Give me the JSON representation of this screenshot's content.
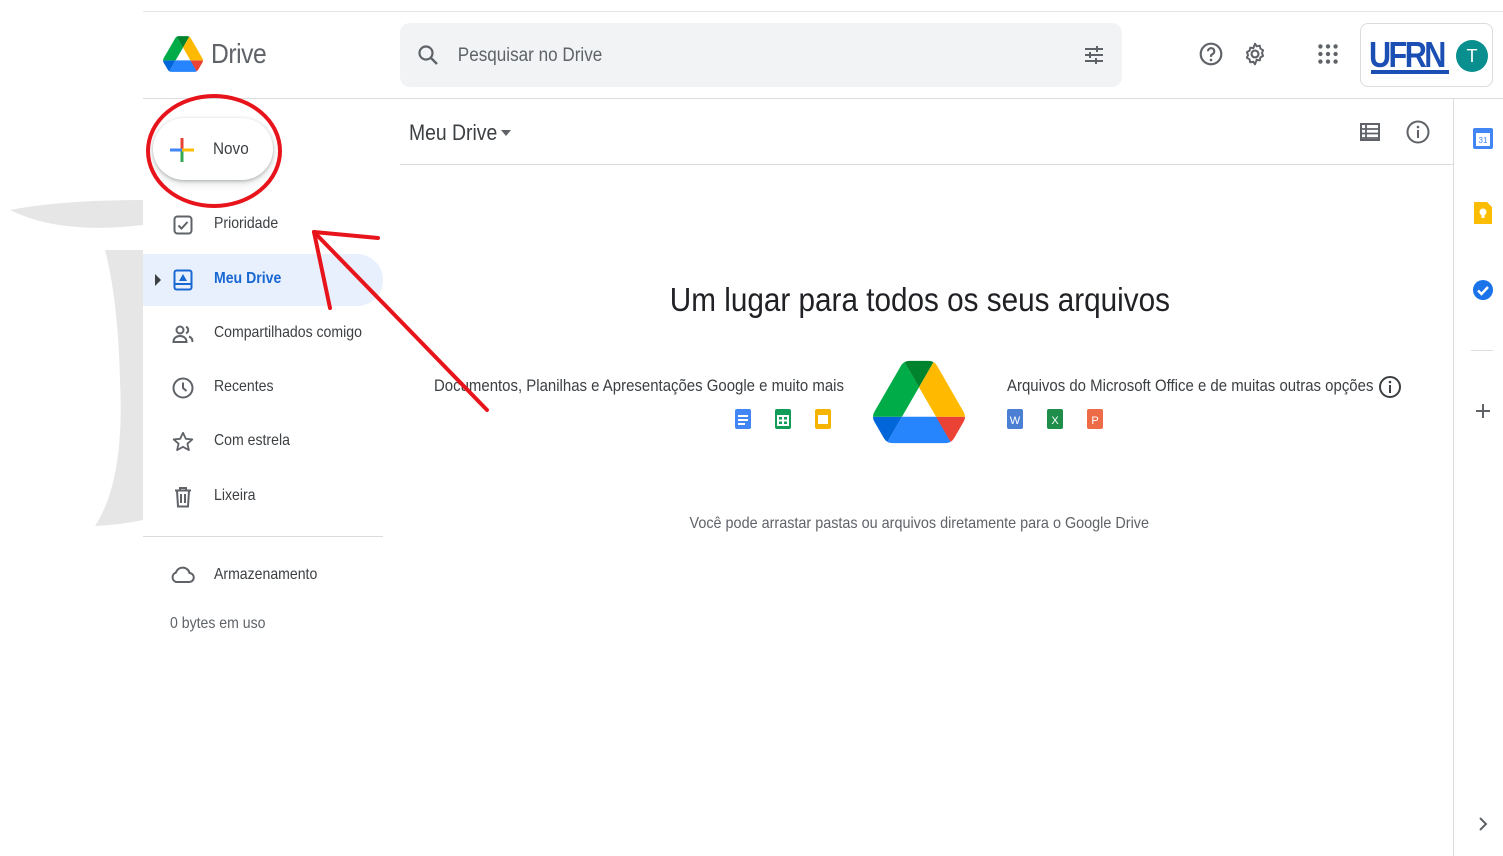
{
  "app": {
    "brand": "Drive",
    "logo_icon": "google-drive-logo-icon"
  },
  "header": {
    "search_placeholder": "Pesquisar no Drive",
    "search_icon": "search-icon",
    "filter_icon": "tune-icon",
    "help_icon": "help-icon",
    "settings_icon": "gear-icon",
    "apps_icon": "apps-grid-icon",
    "org_logo": "UFRN",
    "avatar_letter": "T"
  },
  "sidebar": {
    "new_label": "Novo",
    "items": [
      {
        "label": "Prioridade",
        "icon": "priority-check-icon",
        "active": false
      },
      {
        "label": "Meu Drive",
        "icon": "my-drive-icon",
        "active": true
      },
      {
        "label": "Compartilhados comigo",
        "icon": "shared-people-icon",
        "active": false
      },
      {
        "label": "Recentes",
        "icon": "clock-icon",
        "active": false
      },
      {
        "label": "Com estrela",
        "icon": "star-icon",
        "active": false
      },
      {
        "label": "Lixeira",
        "icon": "trash-icon",
        "active": false
      }
    ],
    "storage_label": "Armazenamento",
    "storage_usage": "0 bytes em uso"
  },
  "main": {
    "breadcrumb": "Meu Drive",
    "empty_title": "Um lugar para todos os seus arquivos",
    "left_caption": "Documentos, Planilhas e Apresentações Google e muito mais",
    "right_caption": "Arquivos do Microsoft Office e de muitas outras opções",
    "office_icons": [
      "W",
      "X",
      "P"
    ],
    "drag_hint": "Você pode arrastar pastas ou arquivos diretamente para o Google Drive"
  },
  "side_panel": [
    "calendar-icon",
    "keep-icon",
    "tasks-icon",
    "add-icon",
    "chevron-right-icon"
  ],
  "colors": {
    "accent": "#1967d2",
    "active_bg": "#e8f0fe",
    "annotation": "#e8141b"
  }
}
